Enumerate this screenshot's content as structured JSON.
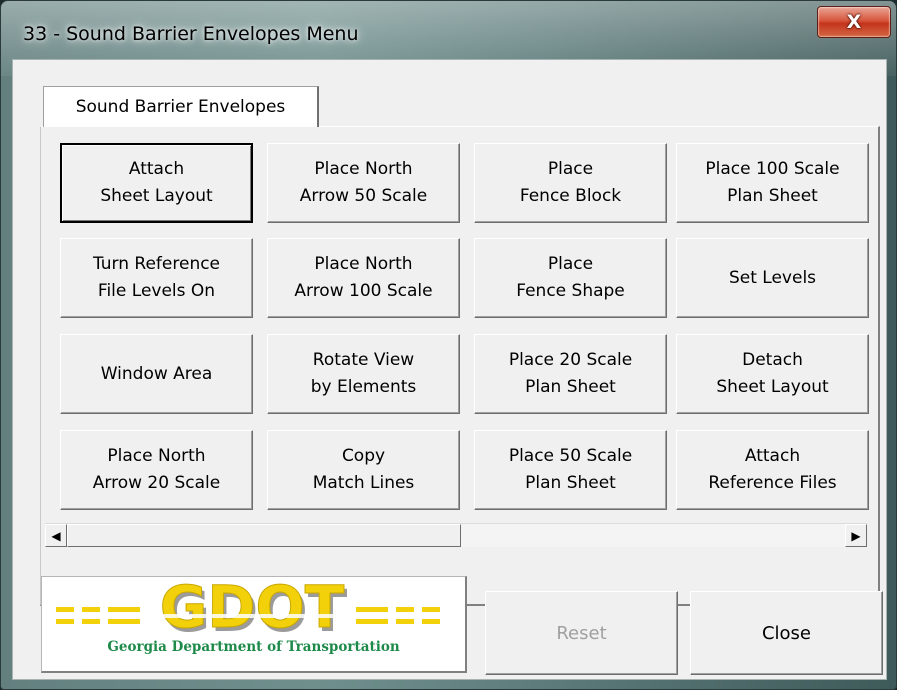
{
  "window": {
    "title": "33 - Sound Barrier Envelopes Menu",
    "close_glyph": "X"
  },
  "tabs": [
    {
      "label": "Sound Barrier Envelopes",
      "selected": true
    }
  ],
  "buttons": [
    {
      "label": "Attach\nSheet Layout",
      "focused": true
    },
    {
      "label": "Place North\nArrow 50 Scale"
    },
    {
      "label": "Place\nFence Block"
    },
    {
      "label": "Place 100 Scale\nPlan Sheet"
    },
    {
      "label": "Turn Reference\nFile Levels On"
    },
    {
      "label": "Place North\nArrow 100 Scale"
    },
    {
      "label": "Place\nFence Shape"
    },
    {
      "label": "Set Levels"
    },
    {
      "label": "Window Area"
    },
    {
      "label": "Rotate View\nby Elements"
    },
    {
      "label": "Place 20 Scale\nPlan Sheet"
    },
    {
      "label": "Detach\nSheet Layout"
    },
    {
      "label": "Place North\nArrow 20 Scale"
    },
    {
      "label": "Copy\nMatch Lines"
    },
    {
      "label": "Place 50 Scale\nPlan Sheet"
    },
    {
      "label": "Attach\nReference Files"
    }
  ],
  "scrollbar": {
    "left_arrow_icon": "triangle-left",
    "right_arrow_icon": "triangle-right",
    "left_glyph": "◀",
    "right_glyph": "▶"
  },
  "logo": {
    "wordmark": "GDOT",
    "caption": "Georgia Department of Transportation"
  },
  "footer": {
    "reset_label": "Reset",
    "reset_enabled": false,
    "close_label": "Close"
  },
  "colors": {
    "logo_yellow": "#f3d10a",
    "logo_gray": "#9b9b9b",
    "logo_green": "#1e8a4a",
    "close_red": "#c4341c"
  }
}
